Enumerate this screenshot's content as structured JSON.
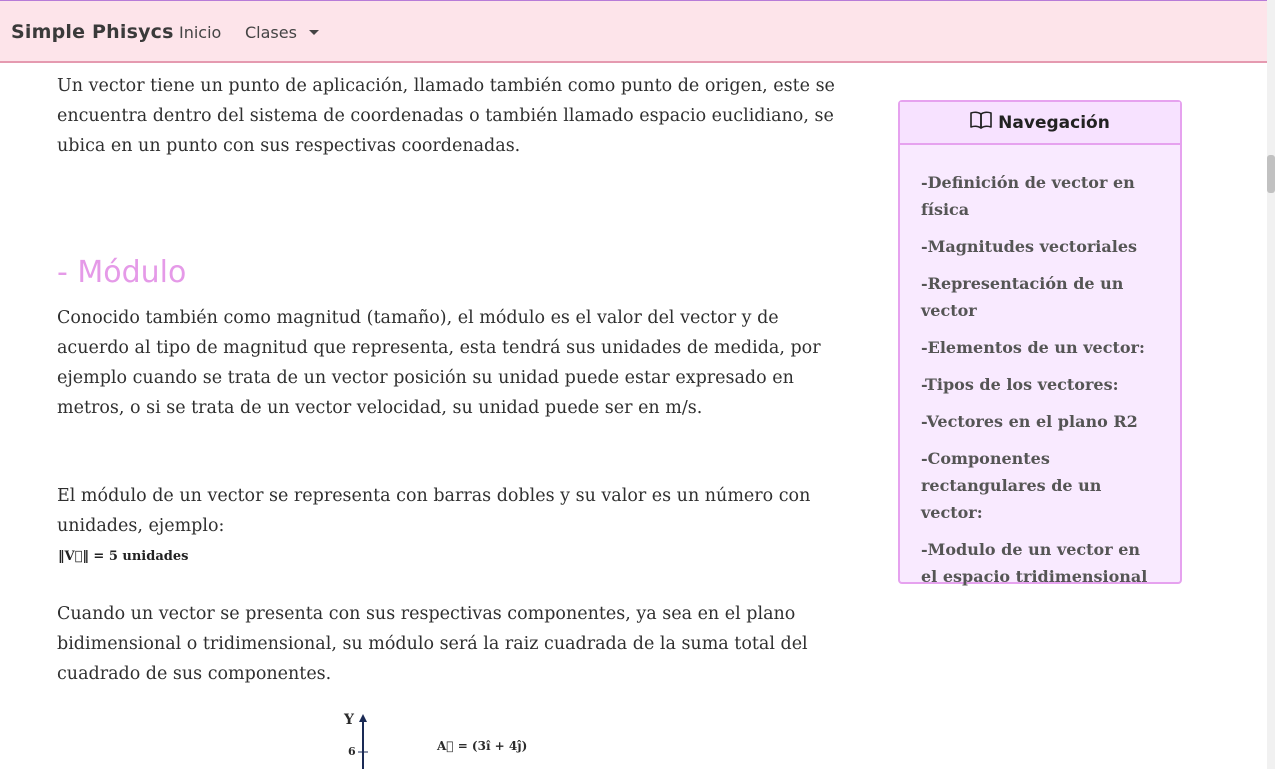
{
  "navbar": {
    "brand": "Simple Phisycs",
    "links": [
      "Inicio",
      "Clases"
    ]
  },
  "content": {
    "p1": "Un vector tiene un punto de aplicación, llamado también como punto de origen, este se encuentra dentro del sistema de coordenadas o también llamado espacio euclidiano, se ubica en un punto con sus respectivas coordenadas.",
    "heading": "- Módulo",
    "p2": "Conocido también como magnitud (tamaño), el módulo es el valor del vector y de acuerdo al tipo de magnitud que representa, esta tendrá sus unidades de medida, por ejemplo cuando se trata de un vector posición su unidad puede estar expresado en metros, o si se trata de un vector velocidad, su unidad puede ser en m/s.",
    "p3": "El módulo de un vector se representa con barras dobles y su valor es un número con unidades, ejemplo:",
    "formula": "‖V⃗‖ = 5 unidades",
    "p4": "Cuando un vector se presenta con sus respectivas componentes, ya sea en el plano bidimensional o tridimensional, su módulo será la raiz cuadrada de la suma total del cuadrado de sus componentes."
  },
  "figure": {
    "y_label": "Y",
    "tick": "6",
    "equation": "A⃗ = (3î + 4ĵ)"
  },
  "sidebar": {
    "title": "Navegación",
    "icon": "book-icon",
    "items": [
      "-Definición de vector en física",
      "-Magnitudes vectoriales",
      "-Representación de un vector",
      "-Elementos de un vector:",
      "-Tipos de los vectores:",
      "-Vectores en el plano R2",
      "-Componentes rectangulares de un vector:",
      "-Modulo de un vector en el espacio tridimensional"
    ]
  },
  "colors": {
    "navbar_bg": "#fde4ea",
    "heading": "#e59ae8",
    "sidebar_border": "#e6a2ef",
    "sidebar_bg": "#f9eaff"
  }
}
